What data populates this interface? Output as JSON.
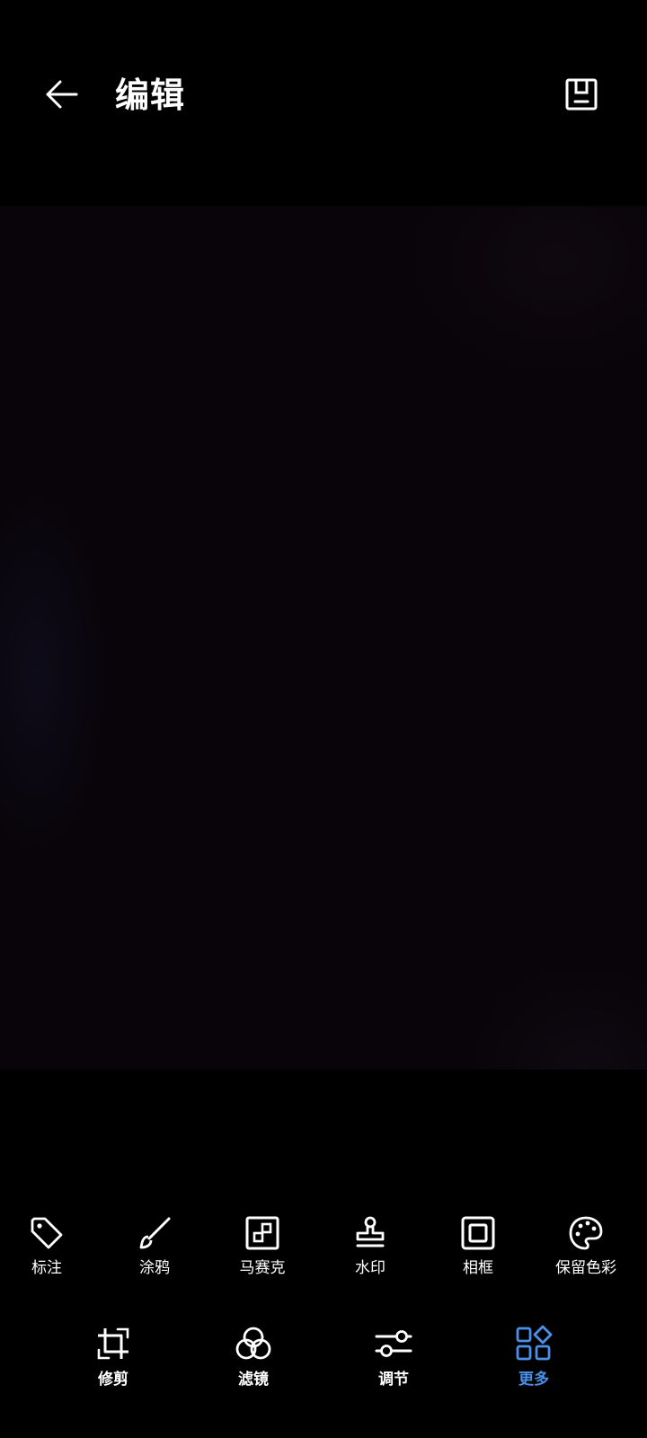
{
  "header": {
    "title": "编辑",
    "back_icon": "arrow-left-icon",
    "save_icon": "save-icon"
  },
  "tools": [
    {
      "label": "标注",
      "icon": "tag-icon"
    },
    {
      "label": "涂鸦",
      "icon": "brush-icon"
    },
    {
      "label": "马赛克",
      "icon": "mosaic-icon"
    },
    {
      "label": "水印",
      "icon": "stamp-icon"
    },
    {
      "label": "相框",
      "icon": "frame-icon"
    },
    {
      "label": "保留色彩",
      "icon": "palette-icon"
    }
  ],
  "tabs": [
    {
      "label": "修剪",
      "icon": "crop-icon",
      "active": false
    },
    {
      "label": "滤镜",
      "icon": "filter-icon",
      "active": false
    },
    {
      "label": "调节",
      "icon": "sliders-icon",
      "active": false
    },
    {
      "label": "更多",
      "icon": "more-grid-icon",
      "active": true
    }
  ],
  "colors": {
    "background": "#000000",
    "active_tab": "#4a8fe8",
    "text": "#ffffff"
  }
}
